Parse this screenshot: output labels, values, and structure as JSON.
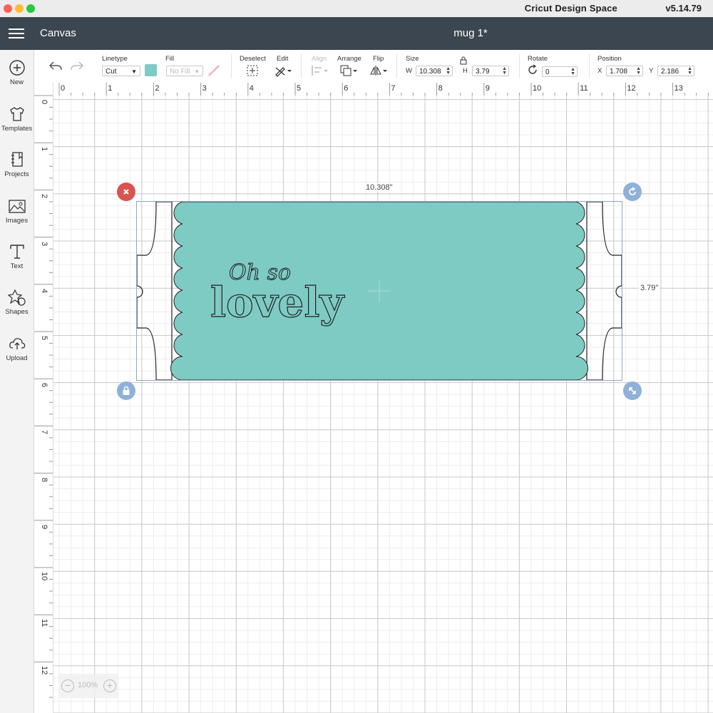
{
  "app": {
    "name": "Cricut Design Space",
    "version": "v5.14.79"
  },
  "header": {
    "section": "Canvas",
    "project_name": "mug 1*"
  },
  "sidebar": {
    "items": [
      {
        "label": "New",
        "icon": "plus-circle-icon"
      },
      {
        "label": "Templates",
        "icon": "tshirt-icon"
      },
      {
        "label": "Projects",
        "icon": "notebook-icon"
      },
      {
        "label": "Images",
        "icon": "image-icon"
      },
      {
        "label": "Text",
        "icon": "text-t-icon"
      },
      {
        "label": "Shapes",
        "icon": "shapes-icon"
      },
      {
        "label": "Upload",
        "icon": "cloud-upload-icon"
      }
    ]
  },
  "toolbar": {
    "linetype_label": "Linetype",
    "linetype_value": "Cut",
    "fill_label": "Fill",
    "fill_value": "No Fill",
    "fill_color": "#7ecbc4",
    "deselect_label": "Deselect",
    "edit_label": "Edit",
    "align_label": "Align",
    "arrange_label": "Arrange",
    "flip_label": "Flip",
    "size_label": "Size",
    "w_label": "W",
    "w_value": "10.308",
    "h_label": "H",
    "h_value": "3.79",
    "rotate_label": "Rotate",
    "rotate_value": "0",
    "position_label": "Position",
    "x_label": "X",
    "x_value": "1.708",
    "y_label": "Y",
    "y_value": "2.186"
  },
  "rulers": {
    "horizontal": [
      "0",
      "1",
      "2",
      "3",
      "4",
      "5",
      "6",
      "7",
      "8",
      "9",
      "10",
      "11",
      "12",
      "13"
    ],
    "vertical": [
      "0",
      "1",
      "2",
      "3",
      "4",
      "5",
      "6",
      "7",
      "8",
      "9",
      "10",
      "11",
      "12"
    ]
  },
  "canvas": {
    "width_label": "10.308\"",
    "height_label": "3.79\"",
    "design_script_text": "Oh so",
    "design_main_text": "lovely",
    "design_color": "#7ecbc4"
  },
  "zoom": {
    "value": "100%"
  },
  "colors": {
    "header_bg": "#3c4650",
    "delete_handle": "#d9534f",
    "handle_blue": "#8fb0d9"
  }
}
